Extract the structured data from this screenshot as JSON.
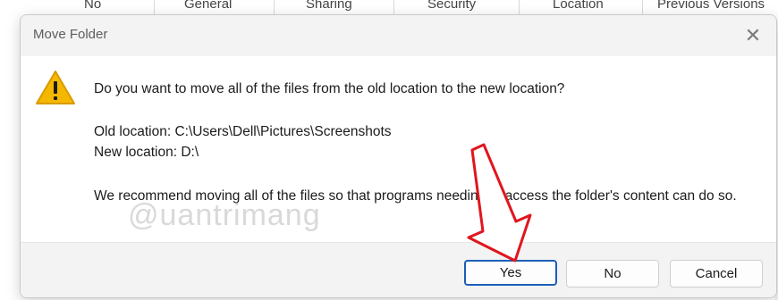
{
  "background": {
    "cells": [
      "No",
      "General",
      "Sharing",
      "Security",
      "Location",
      "Previous Versions"
    ]
  },
  "dialog": {
    "title": "Move Folder",
    "close_glyph": "✕",
    "question": "Do you want to move all of the files from the old location to the new location?",
    "old_location": "Old location: C:\\Users\\Dell\\Pictures\\Screenshots",
    "new_location": "New location: D:\\",
    "recommendation": "We recommend moving all of the files so that programs needing to access the folder's content can do so.",
    "buttons": {
      "yes": "Yes",
      "no": "No",
      "cancel": "Cancel"
    },
    "icon": "warning-icon"
  },
  "watermark": "@uantrimang",
  "colors": {
    "accent": "#1b5fb8",
    "warning": "#f5b800",
    "annotation_arrow": "#e0161d"
  }
}
